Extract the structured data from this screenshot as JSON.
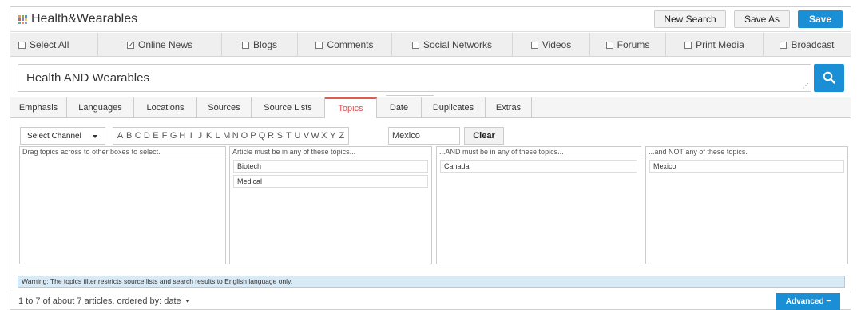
{
  "window": {
    "title": "Health&Wearables",
    "icon": "grid-logo-icon",
    "icon_colors": [
      "#e8a33d",
      "#7cb342",
      "#29a3d8",
      "#e25b5b",
      "#ab6dc2",
      "#f2c744",
      "#4db6ac",
      "#ff8a65",
      "#90a4ae"
    ]
  },
  "toolbar": {
    "new_search_label": "New Search",
    "save_as_label": "Save As",
    "save_label": "Save"
  },
  "media": {
    "items": [
      {
        "label": "Select All",
        "checked": false
      },
      {
        "label": "Online News",
        "checked": true
      },
      {
        "label": "Blogs",
        "checked": false
      },
      {
        "label": "Comments",
        "checked": false
      },
      {
        "label": "Social Networks",
        "checked": false
      },
      {
        "label": "Videos",
        "checked": false
      },
      {
        "label": "Forums",
        "checked": false
      },
      {
        "label": "Print Media",
        "checked": false
      },
      {
        "label": "Broadcast",
        "checked": false
      }
    ]
  },
  "search": {
    "query": "Health AND Wearables",
    "button_icon": "search-icon"
  },
  "tabs": [
    {
      "label": "Emphasis",
      "active": false
    },
    {
      "label": "Languages",
      "active": false
    },
    {
      "label": "Locations",
      "active": false
    },
    {
      "label": "Sources",
      "active": false
    },
    {
      "label": "Source Lists",
      "active": false
    },
    {
      "label": "Topics",
      "active": true
    },
    {
      "label": "Date",
      "active": false
    },
    {
      "label": "Duplicates",
      "active": false
    },
    {
      "label": "Extras",
      "active": false
    }
  ],
  "filter": {
    "channel_label": "Select Channel",
    "letters": [
      "A",
      "B",
      "C",
      "D",
      "E",
      "F",
      "G",
      "H",
      "I",
      "J",
      "K",
      "L",
      "M",
      "N",
      "O",
      "P",
      "Q",
      "R",
      "S",
      "T",
      "U",
      "V",
      "W",
      "X",
      "Y",
      "Z"
    ],
    "topic_search_value": "Mexico",
    "clear_label": "Clear"
  },
  "boxes": [
    {
      "header": "Drag topics across to other boxes to select.",
      "topics": []
    },
    {
      "header": "Article must be in any of these topics...",
      "topics": [
        "Biotech",
        "Medical"
      ]
    },
    {
      "header": "...AND must be in any of these topics...",
      "topics": [
        "Canada"
      ]
    },
    {
      "header": "...and NOT any of these topics.",
      "topics": [
        "Mexico"
      ]
    }
  ],
  "warning": "Warning: The topics filter restricts source lists and search results to English language only.",
  "footer": {
    "status": "1 to 7 of about 7 articles, ordered by: date",
    "advanced_label": "Advanced −"
  },
  "colors": {
    "accent": "#1b8fd6",
    "active_tab": "#d9534f",
    "warning_bg": "#d7eaf6"
  }
}
